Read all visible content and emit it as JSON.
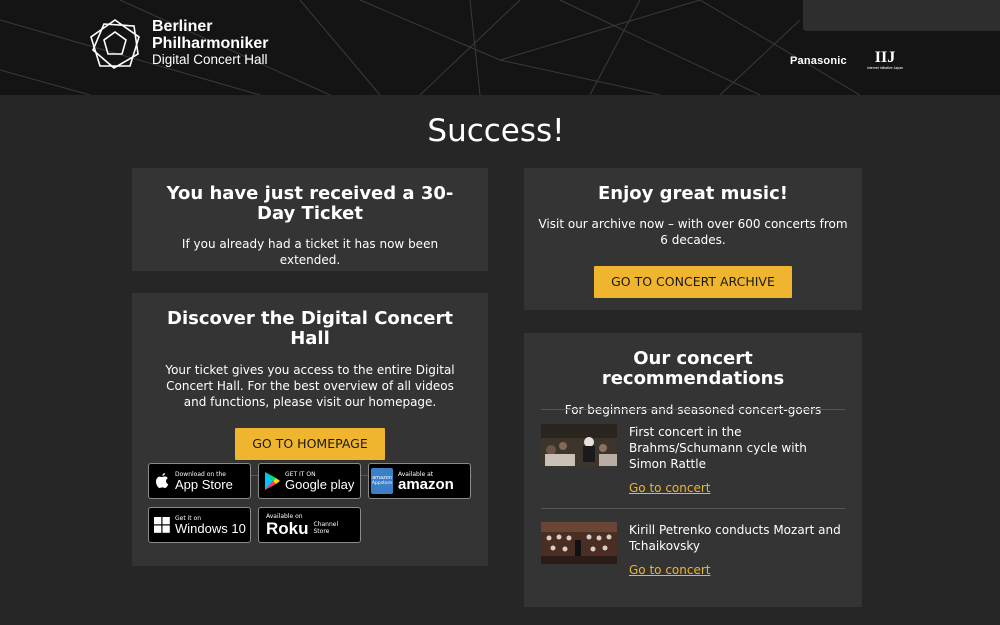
{
  "header": {
    "logo": {
      "line1": "Berliner",
      "line2": "Philharmoniker",
      "line3": "Digital Concert Hall"
    },
    "sponsors": {
      "panasonic": "Panasonic",
      "iij": "IIJ",
      "iij_sub": "Internet Initiative Japan"
    }
  },
  "page_title": "Success!",
  "ticket_panel": {
    "title": "You have just received a 30-Day Ticket",
    "text": "If you already had a ticket it has now been extended."
  },
  "music_panel": {
    "title": "Enjoy great music!",
    "text": "Visit our archive now – with over 600 concerts from 6 decades.",
    "button": "GO TO CONCERT ARCHIVE"
  },
  "discover_panel": {
    "title": "Discover the Digital Concert Hall",
    "text": "Your ticket gives you access to the entire Digital Concert Hall. For the best overview of all videos and functions, please visit our homepage.",
    "button": "GO TO HOMEPAGE",
    "stores": {
      "appstore": {
        "small": "Download on the",
        "big": "App Store"
      },
      "googleplay": {
        "small": "GET IT ON",
        "big": "Google play"
      },
      "amazon": {
        "small": "Available at",
        "big": "amazon",
        "icon_top": "amazon",
        "icon_bottom": "Appstore"
      },
      "windows": {
        "small": "Get it on",
        "big": "Windows 10"
      },
      "roku": {
        "small": "Available on",
        "big": "Roku",
        "side": "Channel Store"
      }
    }
  },
  "recs_panel": {
    "title": "Our concert recommendations",
    "subtitle": "For beginners and seasoned concert-goers",
    "items": [
      {
        "title": "First concert in the Brahms/Schumann cycle with Simon Rattle",
        "link": "Go to concert"
      },
      {
        "title": "Kirill Petrenko conducts Mozart and Tchaikovsky",
        "link": "Go to concert"
      }
    ]
  },
  "colors": {
    "accent": "#f0b52e",
    "background": "#262626",
    "panel": "#343434",
    "header": "#141414"
  }
}
